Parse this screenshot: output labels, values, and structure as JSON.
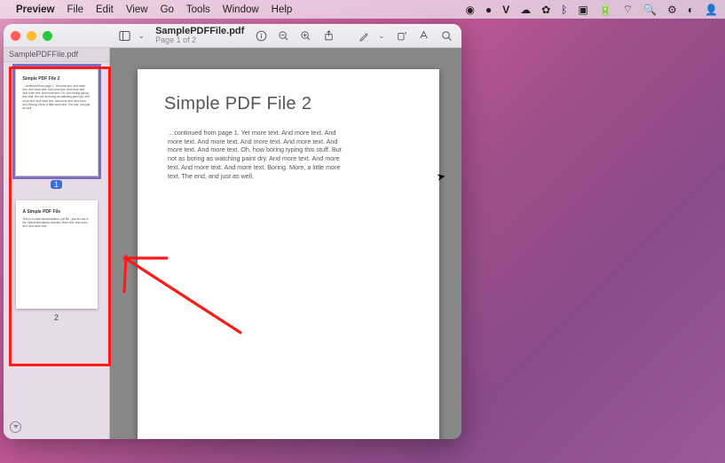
{
  "menubar": {
    "app": "Preview",
    "items": [
      "File",
      "Edit",
      "View",
      "Go",
      "Tools",
      "Window",
      "Help"
    ]
  },
  "window": {
    "filename": "SamplePDFFile.pdf",
    "subtitle": "Page 1 of 2"
  },
  "sidebar": {
    "title": "SamplePDFFile.pdf",
    "thumbs": [
      {
        "title": "Simple PDF File 2",
        "body": "…continued from page 1. Yet more text. And more text. And more text. And more text. And more text. And more text. And more text. Oh, how boring typing this stuff. But not as boring as watching paint dry. And more text. And more text. And more text. And more text. Boring. More, a little more text. The end, and just as well.",
        "page_label": "1",
        "selected": true
      },
      {
        "title": "A Simple PDF File",
        "body": "This is a small demonstration .pdf file - just for use in the Virtual Mechanics tutorials. More text. And more text. And more text.",
        "page_label": "2",
        "selected": false
      }
    ]
  },
  "document": {
    "heading": "Simple PDF File 2",
    "paragraph": "…continued from page 1. Yet more text. And more text. And more text. And more text. And more text. And more text. And more text. And more text. Oh, how boring typing this stuff. But not as boring as watching paint dry. And more text. And more text. And more text. And more text. Boring.  More, a little more text. The end, and just as well."
  },
  "icons": {
    "sidebar_toggle": "sidebar-icon",
    "info": "info-icon",
    "zoom_out": "zoom-out-icon",
    "zoom_in": "zoom-in-icon",
    "share": "share-icon",
    "markup": "markup-icon",
    "rotate": "rotate-icon",
    "highlight": "highlight-icon",
    "search": "search-icon"
  }
}
